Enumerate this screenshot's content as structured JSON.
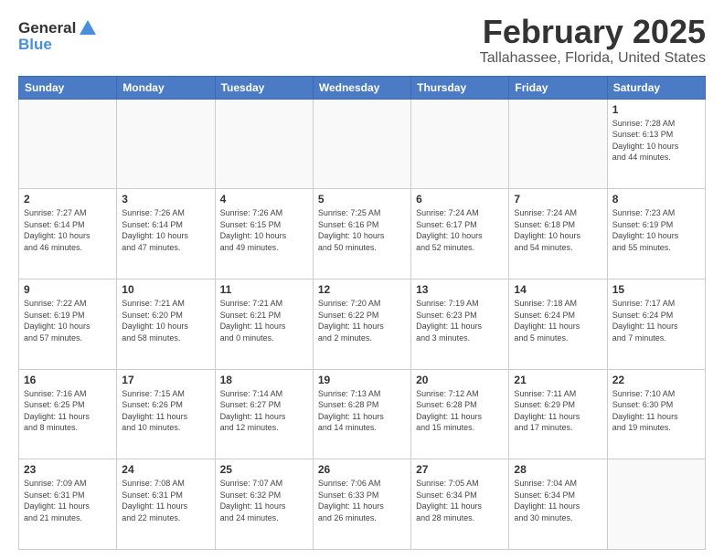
{
  "logo": {
    "line1": "General",
    "line2": "Blue"
  },
  "title": "February 2025",
  "subtitle": "Tallahassee, Florida, United States",
  "weekdays": [
    "Sunday",
    "Monday",
    "Tuesday",
    "Wednesday",
    "Thursday",
    "Friday",
    "Saturday"
  ],
  "weeks": [
    [
      {
        "day": "",
        "info": ""
      },
      {
        "day": "",
        "info": ""
      },
      {
        "day": "",
        "info": ""
      },
      {
        "day": "",
        "info": ""
      },
      {
        "day": "",
        "info": ""
      },
      {
        "day": "",
        "info": ""
      },
      {
        "day": "1",
        "info": "Sunrise: 7:28 AM\nSunset: 6:13 PM\nDaylight: 10 hours\nand 44 minutes."
      }
    ],
    [
      {
        "day": "2",
        "info": "Sunrise: 7:27 AM\nSunset: 6:14 PM\nDaylight: 10 hours\nand 46 minutes."
      },
      {
        "day": "3",
        "info": "Sunrise: 7:26 AM\nSunset: 6:14 PM\nDaylight: 10 hours\nand 47 minutes."
      },
      {
        "day": "4",
        "info": "Sunrise: 7:26 AM\nSunset: 6:15 PM\nDaylight: 10 hours\nand 49 minutes."
      },
      {
        "day": "5",
        "info": "Sunrise: 7:25 AM\nSunset: 6:16 PM\nDaylight: 10 hours\nand 50 minutes."
      },
      {
        "day": "6",
        "info": "Sunrise: 7:24 AM\nSunset: 6:17 PM\nDaylight: 10 hours\nand 52 minutes."
      },
      {
        "day": "7",
        "info": "Sunrise: 7:24 AM\nSunset: 6:18 PM\nDaylight: 10 hours\nand 54 minutes."
      },
      {
        "day": "8",
        "info": "Sunrise: 7:23 AM\nSunset: 6:19 PM\nDaylight: 10 hours\nand 55 minutes."
      }
    ],
    [
      {
        "day": "9",
        "info": "Sunrise: 7:22 AM\nSunset: 6:19 PM\nDaylight: 10 hours\nand 57 minutes."
      },
      {
        "day": "10",
        "info": "Sunrise: 7:21 AM\nSunset: 6:20 PM\nDaylight: 10 hours\nand 58 minutes."
      },
      {
        "day": "11",
        "info": "Sunrise: 7:21 AM\nSunset: 6:21 PM\nDaylight: 11 hours\nand 0 minutes."
      },
      {
        "day": "12",
        "info": "Sunrise: 7:20 AM\nSunset: 6:22 PM\nDaylight: 11 hours\nand 2 minutes."
      },
      {
        "day": "13",
        "info": "Sunrise: 7:19 AM\nSunset: 6:23 PM\nDaylight: 11 hours\nand 3 minutes."
      },
      {
        "day": "14",
        "info": "Sunrise: 7:18 AM\nSunset: 6:24 PM\nDaylight: 11 hours\nand 5 minutes."
      },
      {
        "day": "15",
        "info": "Sunrise: 7:17 AM\nSunset: 6:24 PM\nDaylight: 11 hours\nand 7 minutes."
      }
    ],
    [
      {
        "day": "16",
        "info": "Sunrise: 7:16 AM\nSunset: 6:25 PM\nDaylight: 11 hours\nand 8 minutes."
      },
      {
        "day": "17",
        "info": "Sunrise: 7:15 AM\nSunset: 6:26 PM\nDaylight: 11 hours\nand 10 minutes."
      },
      {
        "day": "18",
        "info": "Sunrise: 7:14 AM\nSunset: 6:27 PM\nDaylight: 11 hours\nand 12 minutes."
      },
      {
        "day": "19",
        "info": "Sunrise: 7:13 AM\nSunset: 6:28 PM\nDaylight: 11 hours\nand 14 minutes."
      },
      {
        "day": "20",
        "info": "Sunrise: 7:12 AM\nSunset: 6:28 PM\nDaylight: 11 hours\nand 15 minutes."
      },
      {
        "day": "21",
        "info": "Sunrise: 7:11 AM\nSunset: 6:29 PM\nDaylight: 11 hours\nand 17 minutes."
      },
      {
        "day": "22",
        "info": "Sunrise: 7:10 AM\nSunset: 6:30 PM\nDaylight: 11 hours\nand 19 minutes."
      }
    ],
    [
      {
        "day": "23",
        "info": "Sunrise: 7:09 AM\nSunset: 6:31 PM\nDaylight: 11 hours\nand 21 minutes."
      },
      {
        "day": "24",
        "info": "Sunrise: 7:08 AM\nSunset: 6:31 PM\nDaylight: 11 hours\nand 22 minutes."
      },
      {
        "day": "25",
        "info": "Sunrise: 7:07 AM\nSunset: 6:32 PM\nDaylight: 11 hours\nand 24 minutes."
      },
      {
        "day": "26",
        "info": "Sunrise: 7:06 AM\nSunset: 6:33 PM\nDaylight: 11 hours\nand 26 minutes."
      },
      {
        "day": "27",
        "info": "Sunrise: 7:05 AM\nSunset: 6:34 PM\nDaylight: 11 hours\nand 28 minutes."
      },
      {
        "day": "28",
        "info": "Sunrise: 7:04 AM\nSunset: 6:34 PM\nDaylight: 11 hours\nand 30 minutes."
      },
      {
        "day": "",
        "info": ""
      }
    ]
  ]
}
